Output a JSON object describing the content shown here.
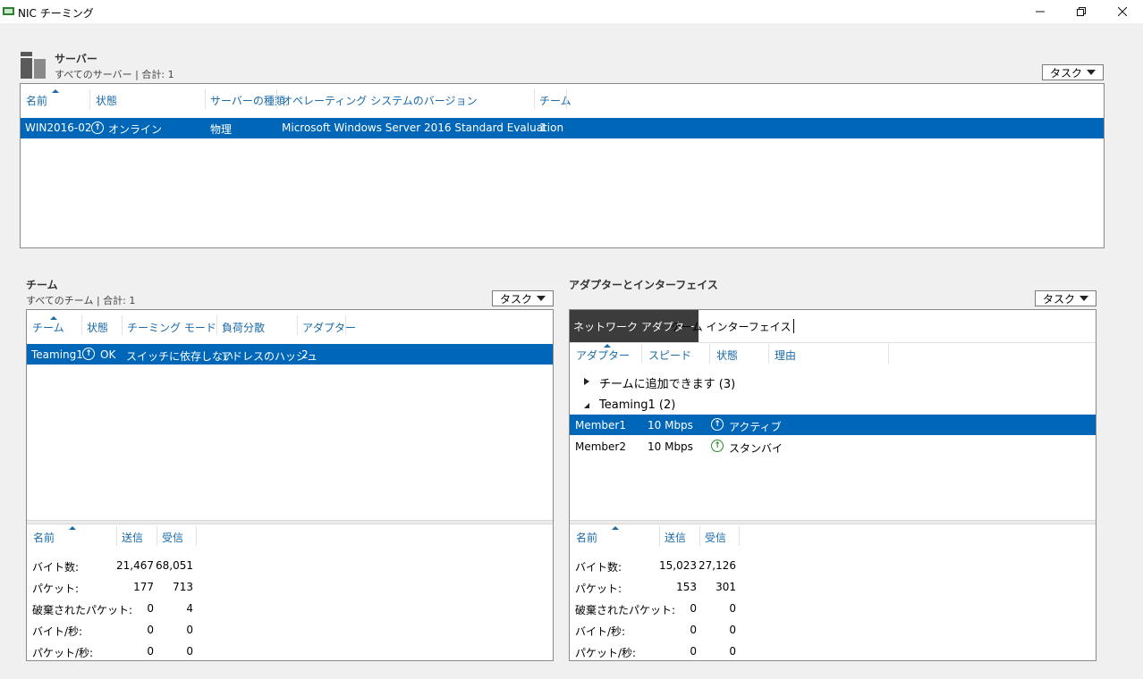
{
  "window": {
    "title": "NIC チーミング",
    "min_icon": "minimize-icon",
    "max_icon": "restore-icon",
    "close_icon": "close-icon"
  },
  "servers": {
    "title": "サーバー",
    "subtitle": "すべてのサーバー | 合計: 1",
    "task_label": "タスク",
    "columns": [
      "名前",
      "状態",
      "サーバーの種類",
      "オペレーティング システムのバージョン",
      "チーム"
    ],
    "rows": [
      {
        "name": "WIN2016-02",
        "status": "オンライン",
        "type": "物理",
        "os": "Microsoft Windows Server 2016 Standard Evaluation",
        "teams": "1"
      }
    ]
  },
  "teams": {
    "title": "チーム",
    "subtitle": "すべてのチーム | 合計: 1",
    "task_label": "タスク",
    "columns": [
      "チーム",
      "状態",
      "チーミング モード",
      "負荷分散",
      "アダプター"
    ],
    "rows": [
      {
        "team": "Teaming1",
        "status": "OK",
        "mode": "スイッチに依存しない",
        "lb": "アドレスのハッシュ",
        "adapters": "2"
      }
    ],
    "stats_columns": [
      "名前",
      "送信",
      "受信"
    ],
    "stats": [
      {
        "label": "バイト数:",
        "sent": "21,467",
        "recv": "68,051"
      },
      {
        "label": "パケット:",
        "sent": "177",
        "recv": "713"
      },
      {
        "label": "破棄されたパケット:",
        "sent": "0",
        "recv": "4"
      },
      {
        "label": "バイト/秒:",
        "sent": "0",
        "recv": "0"
      },
      {
        "label": "パケット/秒:",
        "sent": "0",
        "recv": "0"
      }
    ]
  },
  "adapters": {
    "title": "アダプターとインターフェイス",
    "task_label": "タスク",
    "tabs": [
      "ネットワーク アダプター",
      "チーム インターフェイス"
    ],
    "columns": [
      "アダプター",
      "スピード",
      "状態",
      "理由"
    ],
    "groups": [
      {
        "label": "チームに追加できます (3)",
        "expanded": false
      },
      {
        "label": "Teaming1 (2)",
        "expanded": true
      }
    ],
    "rows": [
      {
        "name": "Member1",
        "speed": "10 Mbps",
        "status": "アクティブ",
        "selected": true
      },
      {
        "name": "Member2",
        "speed": "10 Mbps",
        "status": "スタンバイ",
        "selected": false
      }
    ],
    "stats_columns": [
      "名前",
      "送信",
      "受信"
    ],
    "stats": [
      {
        "label": "バイト数:",
        "sent": "15,023",
        "recv": "27,126"
      },
      {
        "label": "パケット:",
        "sent": "153",
        "recv": "301"
      },
      {
        "label": "破棄されたパケット:",
        "sent": "0",
        "recv": "0"
      },
      {
        "label": "バイト/秒:",
        "sent": "0",
        "recv": "0"
      },
      {
        "label": "パケット/秒:",
        "sent": "0",
        "recv": "0"
      }
    ]
  },
  "colors": {
    "selection": "#0067b8",
    "header_text": "#1a6aa8",
    "status_green": "#2a8a2a"
  }
}
